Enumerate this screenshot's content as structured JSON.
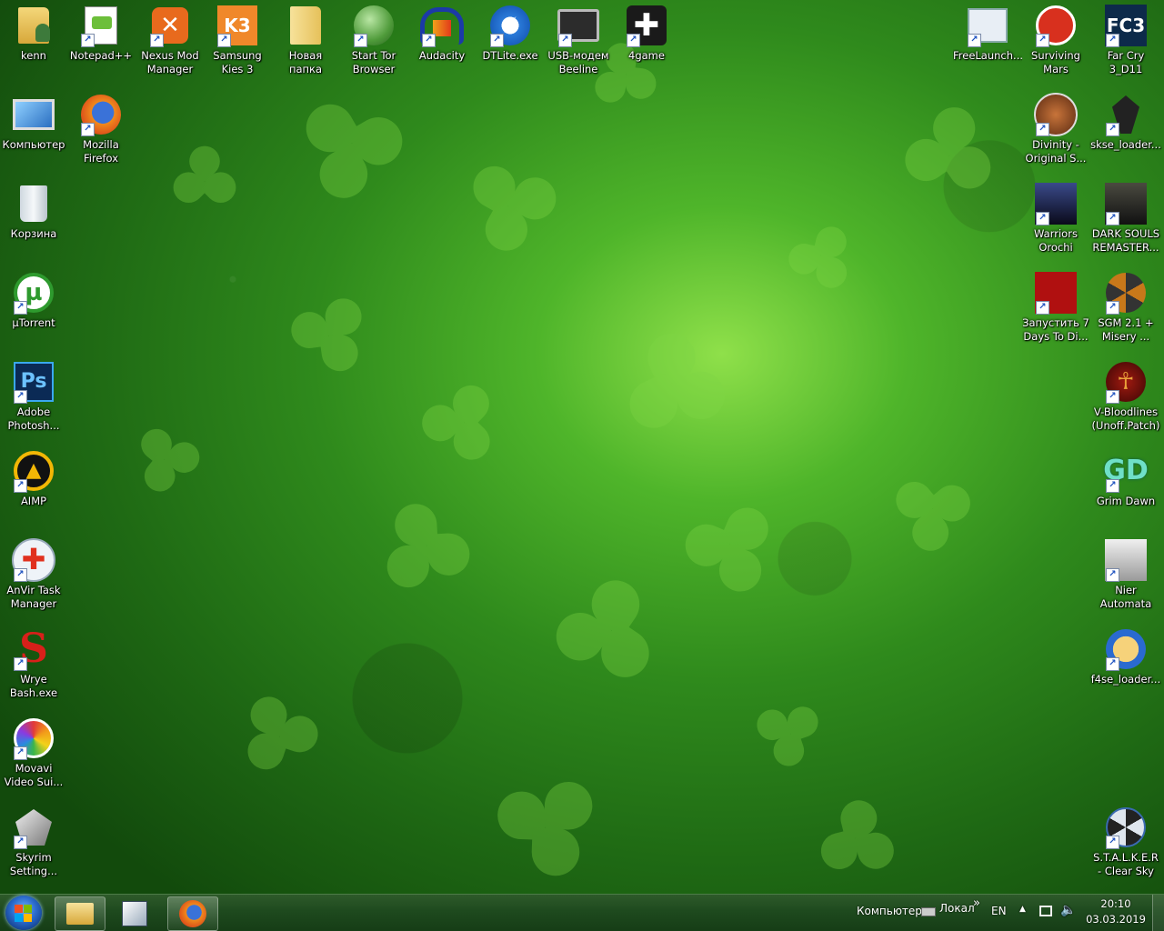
{
  "desktop_left": [
    {
      "label": "kenn",
      "icon": "user-folder-icon"
    },
    {
      "label": "Notepad++",
      "icon": "notepad-plus-icon"
    },
    {
      "label": "Nexus Mod\nManager",
      "icon": "nexus-mod-manager-icon"
    },
    {
      "label": "Samsung\nKies 3",
      "icon": "samsung-kies-icon"
    },
    {
      "label": "Новая папка",
      "icon": "folder-icon"
    },
    {
      "label": "Start Tor\nBrowser",
      "icon": "tor-browser-icon"
    },
    {
      "label": "Audacity",
      "icon": "audacity-icon"
    },
    {
      "label": "DTLite.exe",
      "icon": "daemon-tools-icon"
    },
    {
      "label": "USB-модем\nBeeline",
      "icon": "usb-modem-icon"
    },
    {
      "label": "4game",
      "icon": "4game-icon"
    },
    {
      "label": "Компьютер",
      "icon": "computer-icon"
    },
    {
      "label": "Mozilla\nFirefox",
      "icon": "firefox-icon"
    },
    {
      "label": "Корзина",
      "icon": "recycle-bin-icon"
    },
    {
      "label": "µTorrent",
      "icon": "utorrent-icon"
    },
    {
      "label": "Adobe\nPhotosh...",
      "icon": "photoshop-icon"
    },
    {
      "label": "AIMP",
      "icon": "aimp-icon"
    },
    {
      "label": "AnVir Task\nManager",
      "icon": "anvir-icon"
    },
    {
      "label": "Wrye\nBash.exe",
      "icon": "wrye-bash-icon"
    },
    {
      "label": "Movavi\nVideo Sui...",
      "icon": "movavi-icon"
    },
    {
      "label": "Skyrim\nSetting...",
      "icon": "skyrim-settings-icon"
    }
  ],
  "desktop_right": [
    {
      "label": "FreeLaunch...",
      "icon": "freelaunch-icon"
    },
    {
      "label": "Surviving\nMars",
      "icon": "surviving-mars-icon"
    },
    {
      "label": "Far Cry 3_D11",
      "icon": "far-cry-3-icon"
    },
    {
      "label": "Divinity -\nOriginal S...",
      "icon": "divinity-icon"
    },
    {
      "label": "skse_loader...",
      "icon": "skse-loader-icon"
    },
    {
      "label": "Warriors\nOrochi",
      "icon": "warriors-orochi-icon"
    },
    {
      "label": "DARK SOULS\nREMASTER...",
      "icon": "dark-souls-icon"
    },
    {
      "label": "Запустить 7\nDays To Di...",
      "icon": "7-days-to-die-icon"
    },
    {
      "label": "SGM 2.1 +\nMisery ...",
      "icon": "sgm-misery-icon"
    },
    {
      "label": "V-Bloodlines\n(Unoff.Patch)",
      "icon": "vampire-bloodlines-icon"
    },
    {
      "label": "Grim Dawn",
      "icon": "grim-dawn-icon"
    },
    {
      "label": "Nier\nAutomata",
      "icon": "nier-automata-icon"
    },
    {
      "label": "f4se_loader...",
      "icon": "f4se-loader-icon"
    },
    {
      "label": "S.T.A.L.K.E.R\n- Clear Sky",
      "icon": "stalker-clear-sky-icon"
    }
  ],
  "taskbar": {
    "pinned": [
      "explorer-icon",
      "app-icon",
      "firefox-icon"
    ],
    "toolbar_computer": "Компьютер",
    "toolbar_local": "Локал",
    "chevron": "»",
    "lang": "EN",
    "time": "20:10",
    "date": "03.03.2019"
  },
  "colors": {
    "taskbar": "#1e4a1e",
    "wallpaper": "#2f8a1c"
  }
}
